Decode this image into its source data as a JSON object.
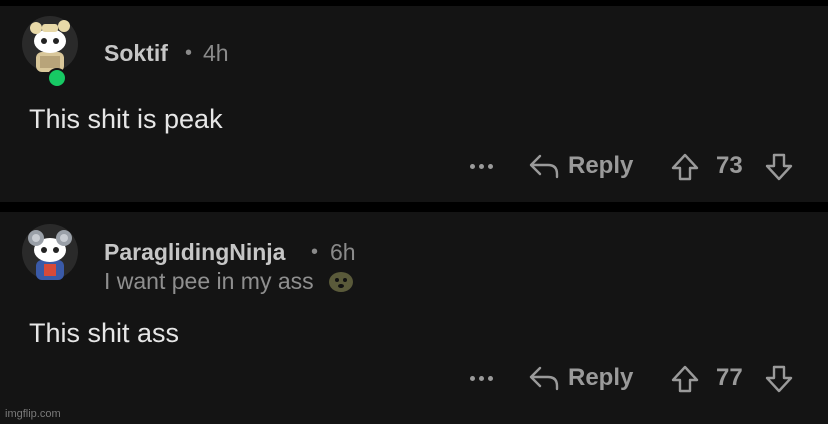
{
  "comments": [
    {
      "username": "Soktif",
      "separator": "•",
      "time": "4h",
      "flair": "",
      "body": "This shit is peak",
      "reply_label": "Reply",
      "score": "73",
      "online": true
    },
    {
      "username": "ParaglidingNinja",
      "separator": "•",
      "time": "6h",
      "flair": "I want pee in my ass",
      "body": "This shit ass",
      "reply_label": "Reply",
      "score": "77",
      "online": false
    }
  ],
  "watermark": "imgflip.com",
  "colors": {
    "background": "#000000",
    "card": "#141414",
    "username": "#c6c6c6",
    "meta": "#8a8a8a",
    "body": "#e6e6e6",
    "online": "#17c964"
  }
}
